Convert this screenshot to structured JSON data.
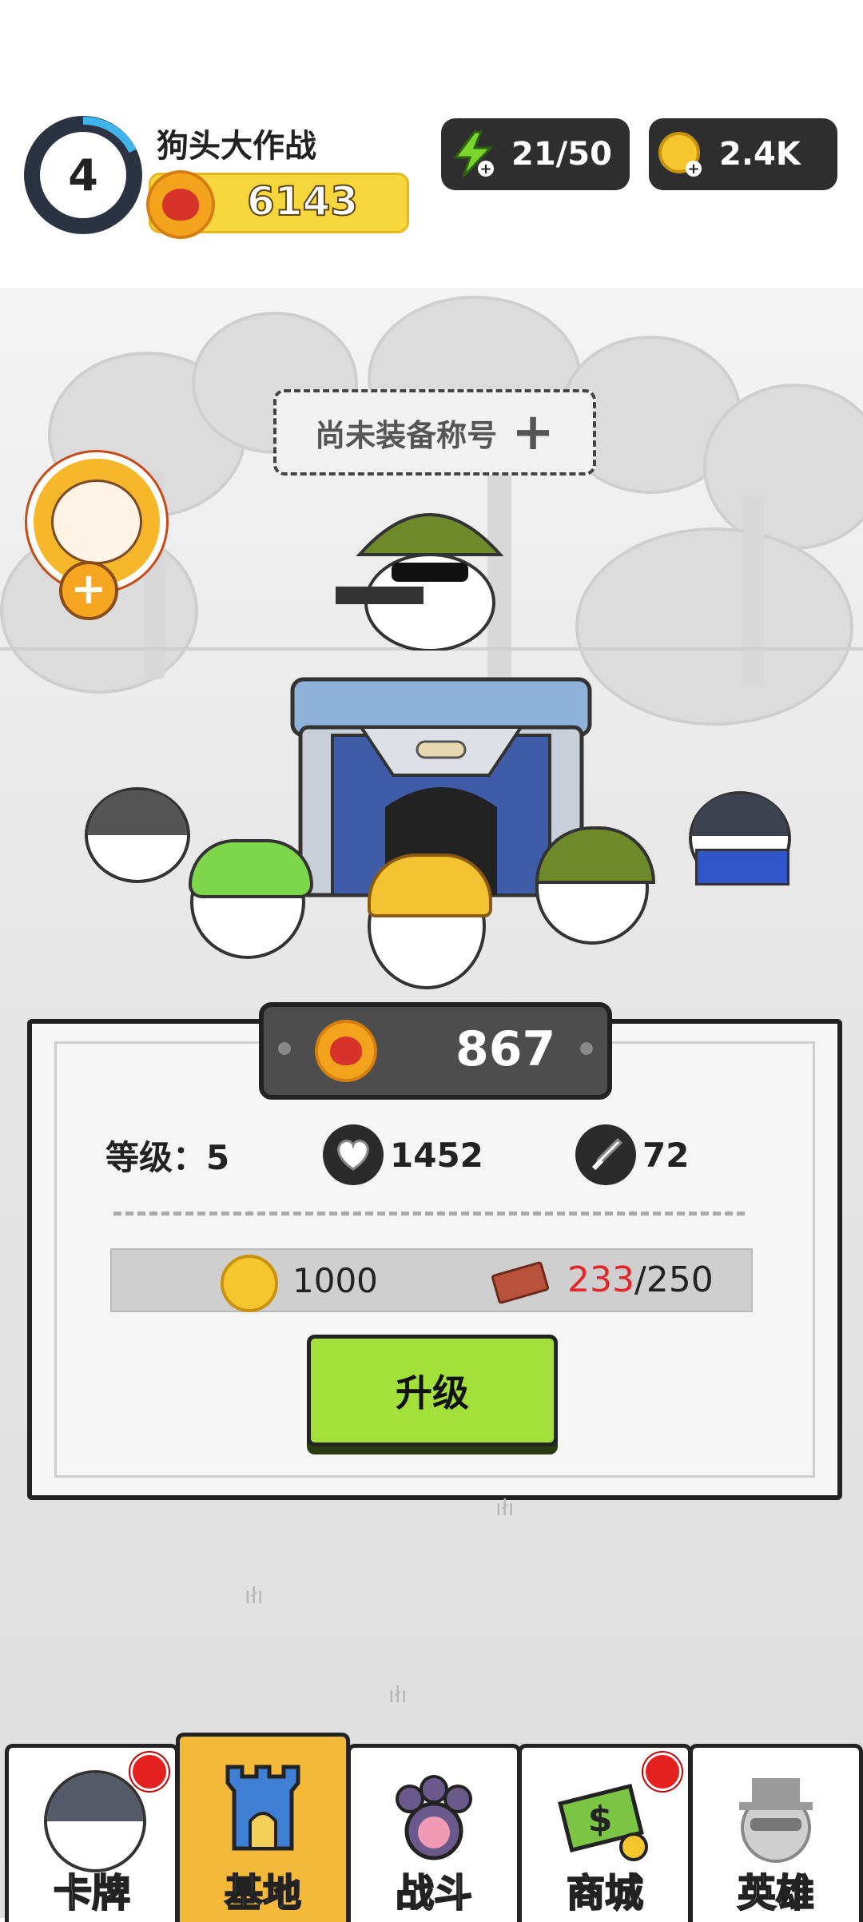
{
  "header": {
    "level": "4",
    "player_name": "狗头大作战",
    "power": "6143",
    "energy": "21/50",
    "coins": "2.4K"
  },
  "title_chip": {
    "text": "尚未装备称号",
    "plus": "+"
  },
  "lucky_cat_plus": "+",
  "upgrade_panel": {
    "cost": "867",
    "level_label": "等级：5",
    "hp": "1452",
    "attack": "72",
    "gold_cost": "1000",
    "material_have": "233",
    "material_need": "/250",
    "upgrade_button": "升级"
  },
  "nav": {
    "tabs": [
      {
        "label": "卡牌",
        "active": false,
        "badge": true
      },
      {
        "label": "基地",
        "active": true,
        "badge": false
      },
      {
        "label": "战斗",
        "active": false,
        "badge": false
      },
      {
        "label": "商城",
        "active": false,
        "badge": true
      },
      {
        "label": "英雄",
        "active": false,
        "badge": false
      }
    ]
  },
  "colors": {
    "accent_yellow": "#f8d73c",
    "upgrade_green": "#a4e03a",
    "active_tab": "#f5b93a",
    "material_red": "#e5262a"
  },
  "icons": [
    "level-ring",
    "boxing-glove-icon",
    "lightning-icon",
    "coin-icon",
    "heart-icon",
    "sword-icon",
    "brick-icon"
  ]
}
